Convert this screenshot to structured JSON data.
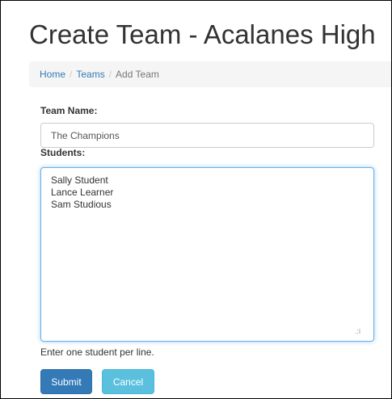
{
  "page": {
    "title": "Create Team - Acalanes High"
  },
  "breadcrumb": {
    "items": [
      "Home",
      "Teams"
    ],
    "active": "Add Team",
    "separator": "/"
  },
  "form": {
    "team_name_label": "Team Name:",
    "team_name_value": "The Champions",
    "students_label": "Students:",
    "students_value": "Sally Student\nLance Learner\nSam Studious",
    "help_text": "Enter one student per line.",
    "submit_label": "Submit",
    "cancel_label": "Cancel",
    "resize_glyph": ".:i"
  },
  "colors": {
    "primary": "#337ab7",
    "info": "#5bc0de",
    "focus_border": "#66afe9"
  }
}
